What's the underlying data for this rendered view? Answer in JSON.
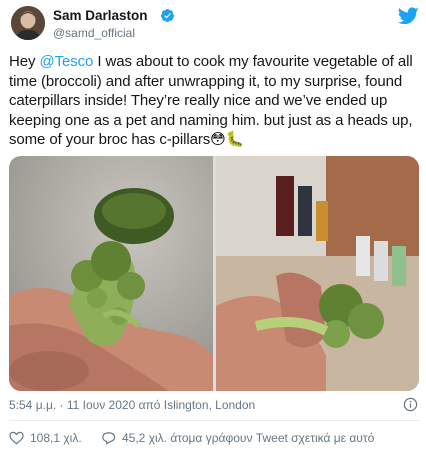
{
  "header": {
    "display_name": "Sam Darlaston",
    "handle": "@samd_official",
    "verified_icon": "verified-badge-icon",
    "brand_icon": "twitter-bird-icon"
  },
  "tweet": {
    "text_before_mention": "Hey ",
    "mention": "@Tesco",
    "text_after_mention": " I was about to cook my favourite vegetable of all time (broccoli) and after unwrapping it, to my surprise, found caterpillars inside! They’re really nice and we’ve ended up keeping one as a pet and naming him. but just as a heads up, some of your broc has c-pillars",
    "emoji": "😳🐛"
  },
  "media": {
    "photos": [
      "broccoli-photo-left",
      "broccoli-photo-right"
    ]
  },
  "meta": {
    "timestamp": "5:54 μ.μ. · 11 Ιουν 2020 από Islington, London",
    "info_icon": "info-icon"
  },
  "actions": {
    "likes": "108,1 χιλ.",
    "replies": "45,2 χιλ. άτομα γράφουν Tweet σχετικά με αυτό"
  },
  "colors": {
    "accent": "#1da1f2",
    "text": "#14171a",
    "secondary": "#657786",
    "divider": "#e6ecf0"
  }
}
